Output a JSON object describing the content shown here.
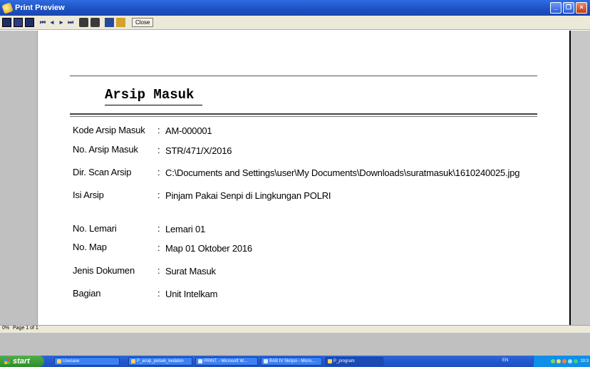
{
  "window": {
    "title": "Print Preview"
  },
  "toolbar": {
    "close_label": "Close"
  },
  "document": {
    "title": "Arsip Masuk",
    "fields": [
      {
        "label": "Kode Arsip Masuk",
        "value": "AM-000001"
      },
      {
        "label": "No. Arsip Masuk",
        "value": "STR/471/X/2016"
      },
      {
        "label": "Dir. Scan Arsip",
        "value": "C:\\Documents and Settings\\user\\My Documents\\Downloads\\suratmasuk\\1610240025.jpg"
      },
      {
        "label": "Isi Arsip",
        "value": "Pinjam Pakai Senpi di Lingkungan POLRI"
      },
      {
        "label": "No. Lemari",
        "value": "Lemari 01"
      },
      {
        "label": "No. Map",
        "value": "Map 01 Oktober 2016"
      },
      {
        "label": "Jenis Dokumen",
        "value": "Surat Masuk"
      },
      {
        "label": "Bagian",
        "value": "Unit Intelkam"
      }
    ]
  },
  "status": {
    "zoom": "0%",
    "page": "Page 1 of 1"
  },
  "taskbar": {
    "start_label": "start",
    "tasks": [
      {
        "label": "Usecase"
      },
      {
        "label": "P_arsip_polsek_kedaton"
      },
      {
        "label": "PRINT. - Microsoft W..."
      },
      {
        "label": "BAB IV Skripsi - Micro..."
      },
      {
        "label": "P_program"
      }
    ],
    "language": "EN",
    "clock": "19:3"
  }
}
